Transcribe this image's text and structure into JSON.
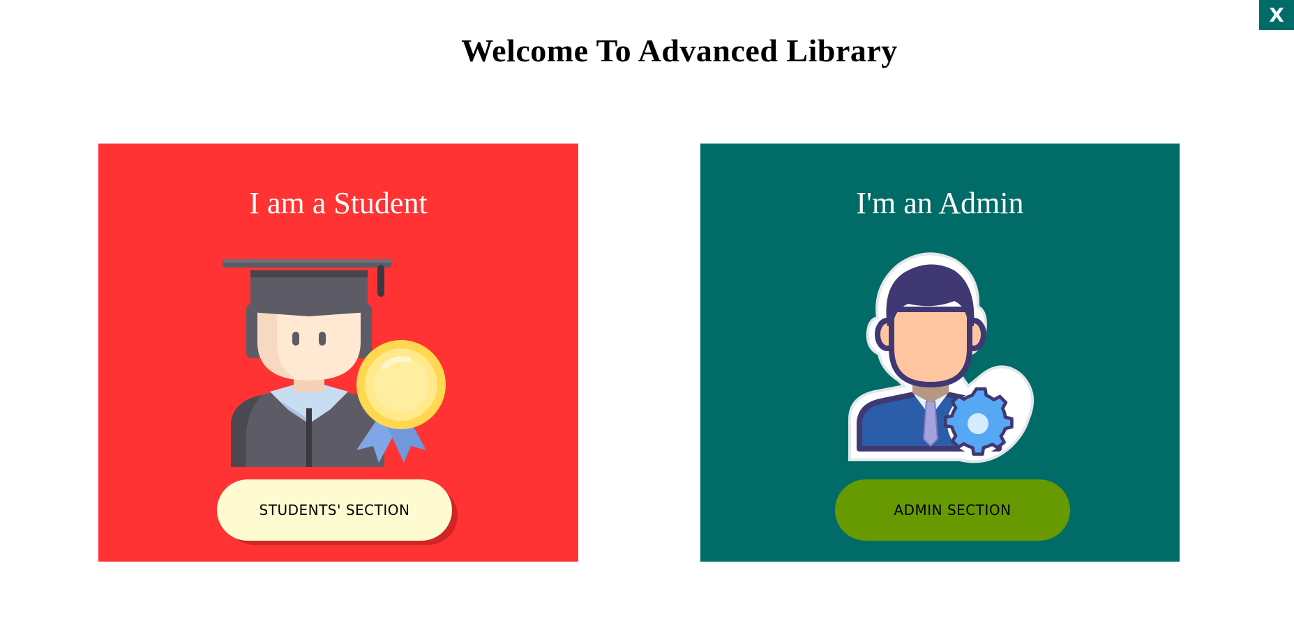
{
  "page": {
    "title": "Welcome To Advanced Library",
    "close_label": "X"
  },
  "colors": {
    "close_bg": "#006b67",
    "student_card_bg": "#ff3334",
    "admin_card_bg": "#006b67",
    "student_button_bg": "#fffbd1",
    "admin_button_bg": "#669a00"
  },
  "cards": {
    "student": {
      "title": "I am a Student",
      "icon": "graduate-student-icon",
      "button_label": "STUDENTS' SECTION"
    },
    "admin": {
      "title": "I'm an Admin",
      "icon": "admin-settings-icon",
      "button_label": "ADMIN SECTION"
    }
  }
}
